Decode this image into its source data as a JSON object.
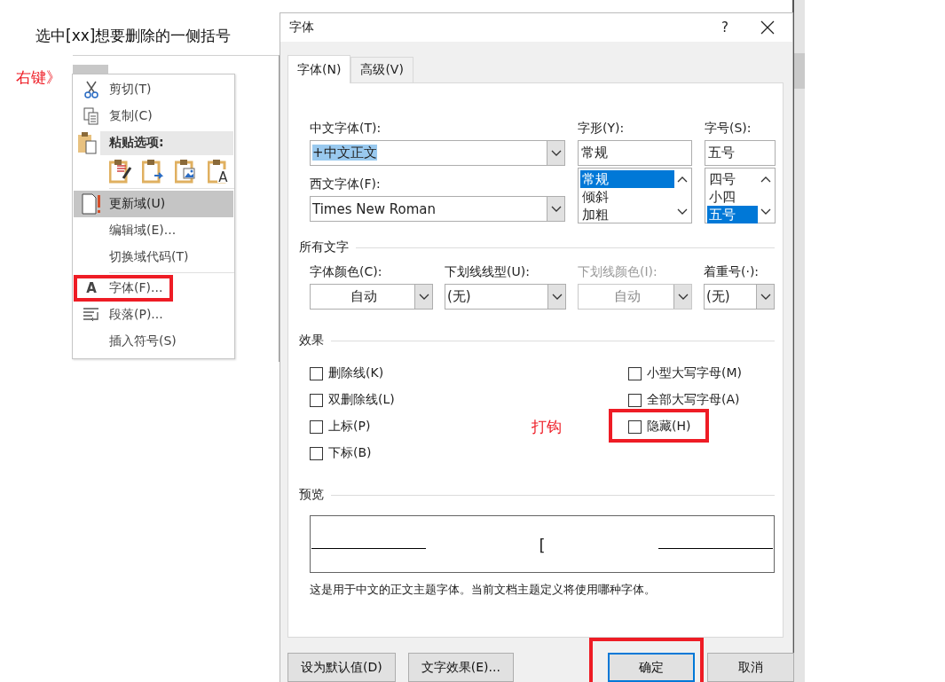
{
  "annotations": {
    "instruction": "选中[xx]想要删除的一侧括号",
    "right_click": "右键》",
    "tick_hint": "打钩"
  },
  "document": {
    "selection": true
  },
  "context_menu": {
    "items": [
      {
        "kind": "command",
        "label": "剪切(T)",
        "selected": false
      },
      {
        "kind": "command",
        "label": "复制(C)",
        "selected": false
      },
      {
        "kind": "header",
        "label": "粘贴选项:"
      },
      {
        "kind": "paste_icons",
        "options": [
          {
            "kind": "formatting"
          },
          {
            "kind": "link"
          },
          {
            "kind": "picture"
          },
          {
            "kind": "text",
            "glyph": "A"
          }
        ]
      },
      {
        "kind": "separator"
      },
      {
        "kind": "command",
        "label": "更新域(U)",
        "selected": true
      },
      {
        "kind": "command",
        "label": "编辑域(E)...",
        "selected": false
      },
      {
        "kind": "command",
        "label": "切换域代码(T)",
        "selected": false
      },
      {
        "kind": "separator"
      },
      {
        "kind": "command",
        "label": "字体(F)...",
        "glyph": "A",
        "selected": false,
        "annotated": true
      },
      {
        "kind": "command",
        "label": "段落(P)...",
        "selected": false
      },
      {
        "kind": "command",
        "label": "插入符号(S)",
        "selected": false
      }
    ]
  },
  "dialog": {
    "title": "字体",
    "help": "?",
    "tabs": [
      {
        "label": "字体(N)",
        "selected": true
      },
      {
        "label": "高级(V)",
        "selected": false
      }
    ],
    "chinese_font": {
      "label": "中文字体(T):",
      "value": "+中文正文",
      "text_selected": true
    },
    "western_font": {
      "label": "西文字体(F):",
      "value": "Times New Roman",
      "text_selected": false
    },
    "font_style": {
      "label": "字形(Y):",
      "value": "常规",
      "options": [
        {
          "label": "常规",
          "selected": true
        },
        {
          "label": "倾斜",
          "selected": false
        },
        {
          "label": "加粗",
          "selected": false
        }
      ]
    },
    "font_size": {
      "label": "字号(S):",
      "value": "五号",
      "options": [
        {
          "label": "四号",
          "selected": false
        },
        {
          "label": "小四",
          "selected": false
        },
        {
          "label": "五号",
          "selected": true
        }
      ]
    },
    "all_text": {
      "title": "所有文字",
      "dropdowns": [
        {
          "label": "字体颜色(C):",
          "value": "自动",
          "centered": true,
          "disabled": false
        },
        {
          "label": "下划线线型(U):",
          "value": "(无)",
          "centered": false,
          "disabled": false
        },
        {
          "label": "下划线颜色(I):",
          "value": "自动",
          "centered": true,
          "disabled": true
        },
        {
          "label": "着重号(·):",
          "value": "(无)",
          "centered": false,
          "disabled": false
        }
      ]
    },
    "effects": {
      "title": "效果",
      "left": [
        {
          "label": "删除线(K)",
          "checked": false
        },
        {
          "label": "双删除线(L)",
          "checked": false
        },
        {
          "label": "上标(P)",
          "checked": false
        },
        {
          "label": "下标(B)",
          "checked": false
        }
      ],
      "right": [
        {
          "label": "小型大写字母(M)",
          "checked": false
        },
        {
          "label": "全部大写字母(A)",
          "checked": false
        },
        {
          "label": "隐藏(H)",
          "checked": false,
          "annotated": true
        }
      ]
    },
    "preview": {
      "title": "预览",
      "sample": "[",
      "description": "这是用于中文的正文主题字体。当前文档主题定义将使用哪种字体。"
    },
    "buttons": [
      {
        "label": "设为默认值(D)",
        "default": false
      },
      {
        "label": "文字效果(E)...",
        "default": false
      },
      {
        "label": "确定",
        "default": true,
        "annotated": true
      },
      {
        "label": "取消",
        "default": false
      }
    ]
  }
}
